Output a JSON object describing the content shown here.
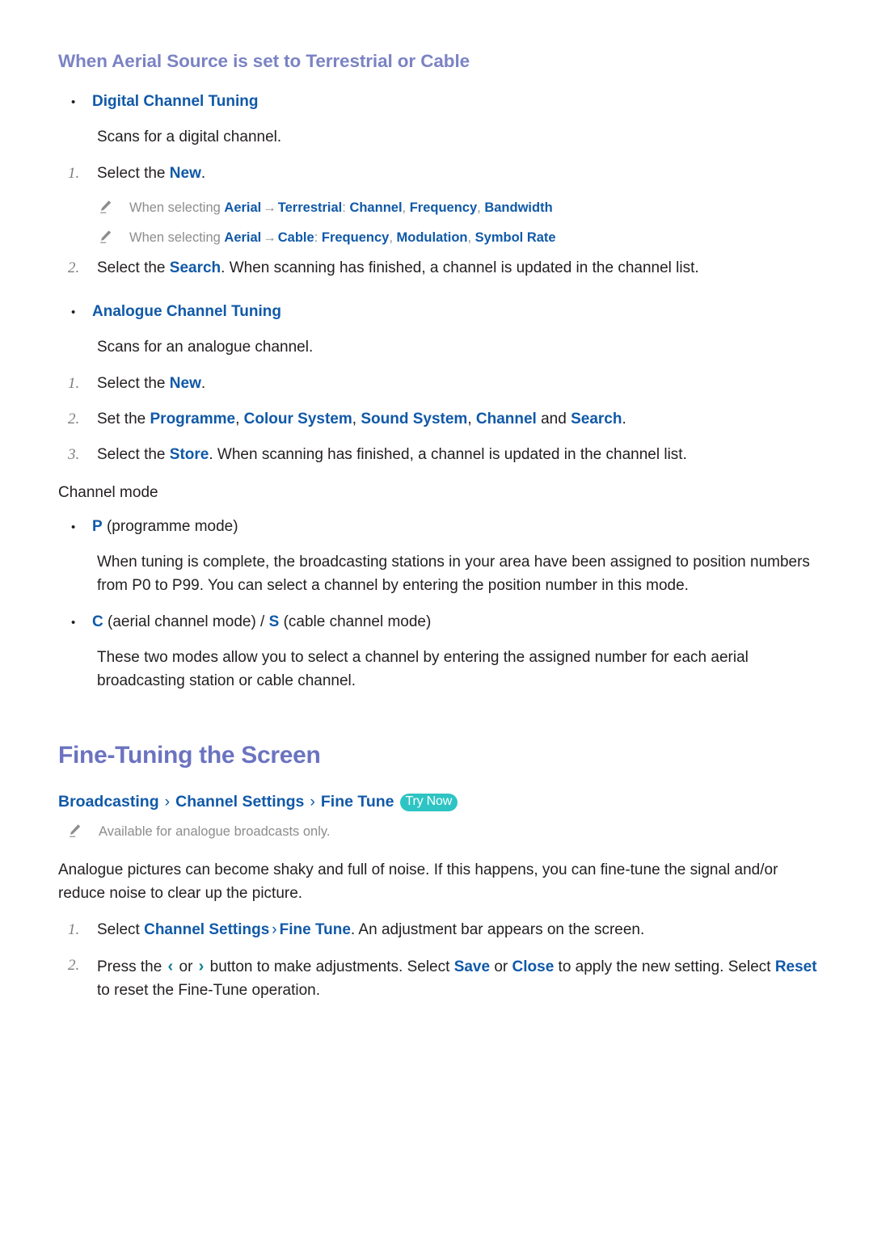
{
  "section": {
    "heading": "When Aerial Source is set to Terrestrial or Cable"
  },
  "digital": {
    "bullet_label": "Digital Channel Tuning",
    "description": "Scans for a digital channel.",
    "step1": {
      "marker": "1.",
      "prefix": "Select the ",
      "link": "New",
      "suffix": "."
    },
    "note1": {
      "lead": "When selecting ",
      "term1": "Aerial",
      "arrow": "→",
      "term2": "Terrestrial",
      "colon": ": ",
      "opt1": "Channel",
      "sep1": ", ",
      "opt2": "Frequency",
      "sep2": ", ",
      "opt3": "Bandwidth"
    },
    "note2": {
      "lead": "When selecting ",
      "term1": "Aerial",
      "arrow": "→",
      "term2": "Cable",
      "colon": ": ",
      "opt1": "Frequency",
      "sep1": ", ",
      "opt2": "Modulation",
      "sep2": ", ",
      "opt3": "Symbol Rate"
    },
    "step2": {
      "marker": "2.",
      "prefix": "Select the ",
      "link": "Search",
      "suffix": ". When scanning has finished, a channel is updated in the channel list."
    }
  },
  "analogue": {
    "bullet_label": "Analogue Channel Tuning",
    "description": "Scans for an analogue channel.",
    "step1": {
      "marker": "1.",
      "prefix": "Select the ",
      "link": "New",
      "suffix": "."
    },
    "step2": {
      "marker": "2.",
      "prefix": "Set the ",
      "l1": "Programme",
      "s1": ", ",
      "l2": "Colour System",
      "s2": ", ",
      "l3": "Sound System",
      "s3": ", ",
      "l4": "Channel",
      "mid": " and ",
      "l5": "Search",
      "suffix": "."
    },
    "step3": {
      "marker": "3.",
      "prefix": "Select the ",
      "link": "Store",
      "suffix": ". When scanning has finished, a channel is updated in the channel list."
    }
  },
  "channel_mode": {
    "heading": "Channel mode",
    "item_p": {
      "code": "P",
      "text": " (programme mode)"
    },
    "para_p": "When tuning is complete, the broadcasting stations in your area have been assigned to position numbers from P0 to P99. You can select a channel by entering the position number in this mode.",
    "item_cs": {
      "code1": "C",
      "text1": " (aerial channel mode) / ",
      "code2": "S",
      "text2": " (cable channel mode)"
    },
    "para_cs": "These two modes allow you to select a channel by entering the assigned number for each aerial broadcasting station or cable channel."
  },
  "fine_tuning": {
    "heading": "Fine-Tuning the Screen",
    "breadcrumb": {
      "item1": "Broadcasting",
      "sep": "›",
      "item2": "Channel Settings",
      "item3": "Fine Tune",
      "badge": "Try Now"
    },
    "note": "Available for analogue broadcasts only.",
    "intro": "Analogue pictures can become shaky and full of noise. If this happens, you can fine-tune the signal and/or reduce noise to clear up the picture.",
    "step1": {
      "marker": "1.",
      "prefix": "Select ",
      "l1": "Channel Settings",
      "sep": "›",
      "l2": "Fine Tune",
      "suffix": ". An adjustment bar appears on the screen."
    },
    "step2": {
      "marker": "2.",
      "p1": "Press the ",
      "glyph_left": "‹",
      "p2": " or ",
      "glyph_right": "›",
      "p3": " button to make adjustments. Select ",
      "l1": "Save",
      "p4": " or ",
      "l2": "Close",
      "p5": " to apply the new setting. Select ",
      "l3": "Reset",
      "p6": " to reset the Fine-Tune operation."
    }
  },
  "colors": {
    "link_blue": "#1059a8",
    "heading_purple": "#7b83c4",
    "title_purple": "#6b73c0",
    "badge_teal": "#2ec4c4",
    "glyph_teal": "#0d7f8f",
    "note_gray": "#8d8d8d"
  }
}
